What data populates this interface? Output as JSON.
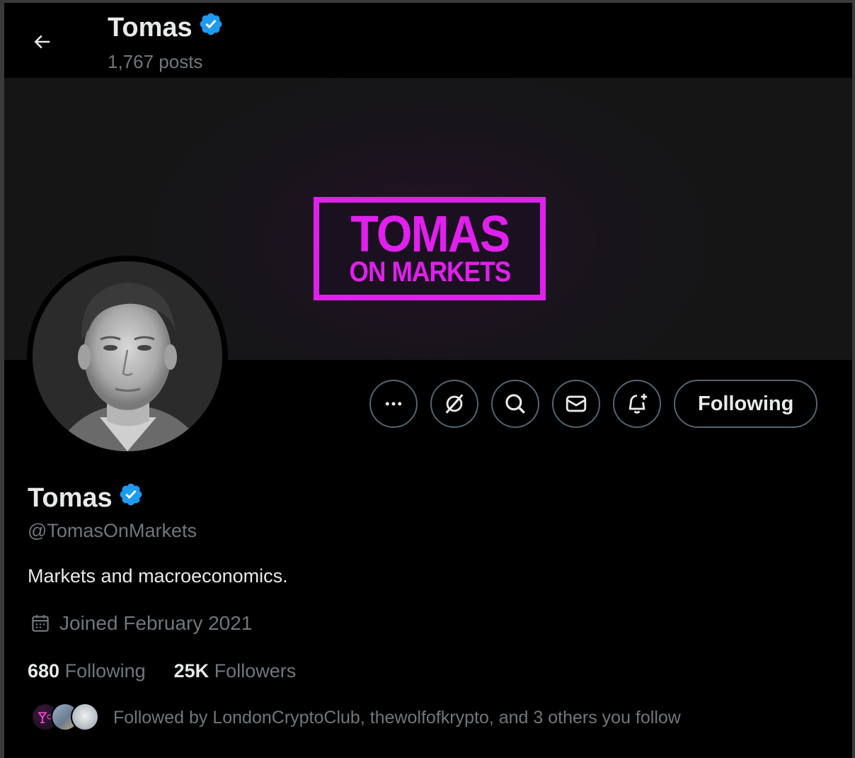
{
  "header": {
    "name": "Tomas",
    "posts": "1,767 posts"
  },
  "banner": {
    "logo_line1": "TOMAS",
    "logo_line2": "ON MARKETS",
    "accent": "#e020ec"
  },
  "actions": {
    "following_label": "Following"
  },
  "profile": {
    "name": "Tomas",
    "handle": "@TomasOnMarkets",
    "bio": "Markets and macroeconomics.",
    "joined": "Joined February 2021",
    "following_count": "680",
    "following_label": "Following",
    "followers_count": "25K",
    "followers_label": "Followers",
    "followed_by": "Followed by LondonCryptoClub, thewolfofkrypto, and 3 others you follow"
  },
  "icons": {
    "back": "arrow-left-icon",
    "verified": "verified-badge-icon",
    "more": "more-icon",
    "grok": "grok-icon",
    "search": "search-icon",
    "message": "envelope-icon",
    "notify": "bell-plus-icon",
    "calendar": "calendar-icon"
  },
  "colors": {
    "background": "#000000",
    "text_primary": "#e7e9ea",
    "text_secondary": "#71767b",
    "border": "#536471",
    "verified_blue": "#1d9bf0"
  }
}
